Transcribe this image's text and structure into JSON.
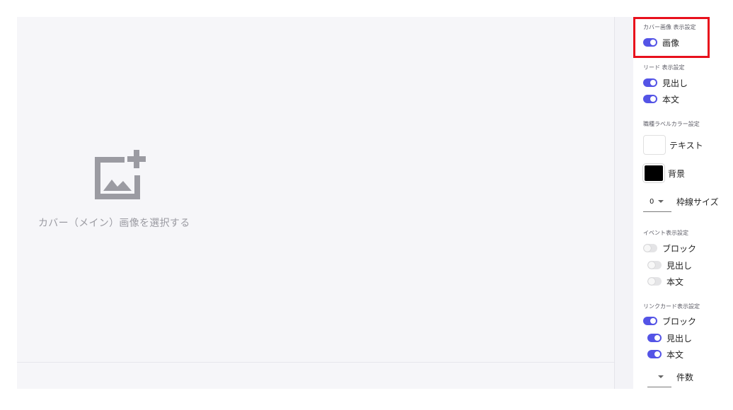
{
  "canvas": {
    "placeholder_label": "カバー（メイン）画像を選択する",
    "icon": "add-image-icon"
  },
  "sidebar": {
    "cover_section": {
      "title": "カバー画像 表示設定",
      "toggles": [
        {
          "label": "画像",
          "on": true
        }
      ]
    },
    "lead_section": {
      "title": "リード 表示設定",
      "toggles": [
        {
          "label": "見出し",
          "on": true
        },
        {
          "label": "本文",
          "on": true
        }
      ]
    },
    "label_color_section": {
      "title": "職種ラベルカラー設定",
      "text_color_label": "テキスト",
      "text_color": "#ffffff",
      "bg_color_label": "背景",
      "bg_color": "#000000",
      "border_size_value": "0",
      "border_size_label": "枠線サイズ"
    },
    "event_section": {
      "title": "イベント表示設定",
      "toggles": [
        {
          "label": "ブロック",
          "on": false
        },
        {
          "label": "見出し",
          "on": false
        },
        {
          "label": "本文",
          "on": false
        }
      ]
    },
    "link_card_section": {
      "title": "リンクカード表示設定",
      "toggles": [
        {
          "label": "ブロック",
          "on": true
        },
        {
          "label": "見出し",
          "on": true
        },
        {
          "label": "本文",
          "on": true
        }
      ],
      "count_value": "",
      "count_label": "件数"
    }
  },
  "colors": {
    "toggle_on": "#5454e6",
    "highlight": "#e8101c",
    "canvas_bg": "#f6f6f9"
  }
}
